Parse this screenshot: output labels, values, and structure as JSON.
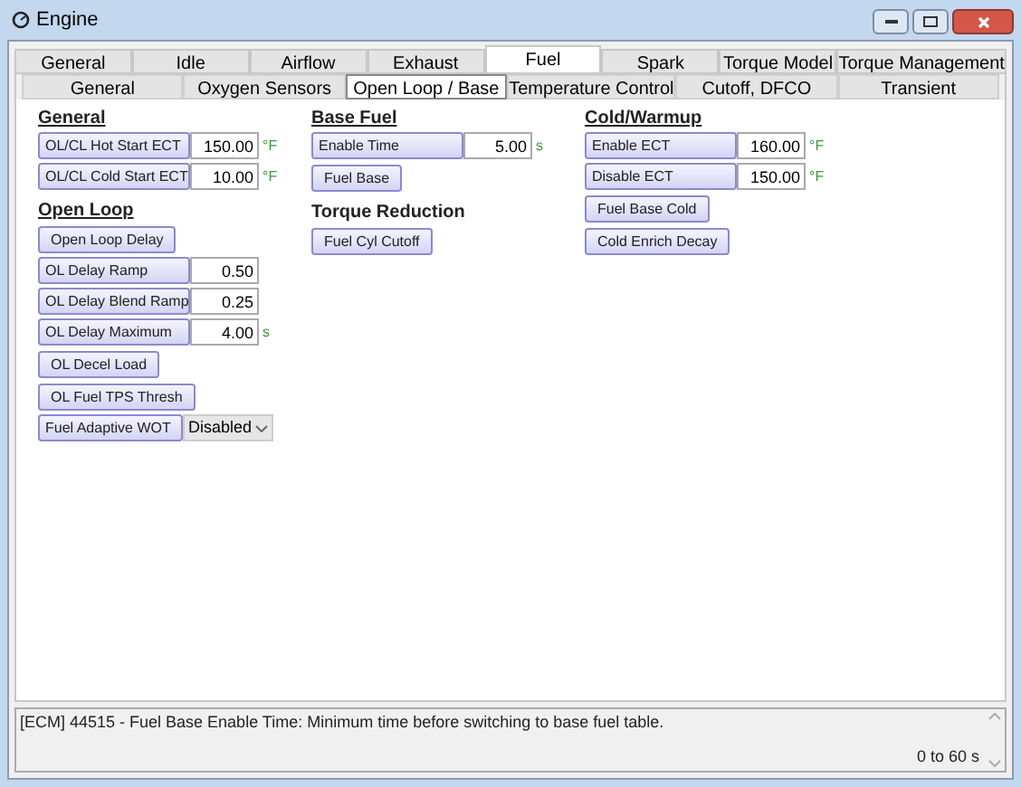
{
  "window": {
    "title": "Engine"
  },
  "tabs": [
    {
      "label": "General",
      "selected": false
    },
    {
      "label": "Idle",
      "selected": false
    },
    {
      "label": "Airflow",
      "selected": false
    },
    {
      "label": "Exhaust",
      "selected": false
    },
    {
      "label": "Fuel",
      "selected": true
    },
    {
      "label": "Spark",
      "selected": false
    },
    {
      "label": "Torque Model",
      "selected": false
    },
    {
      "label": "Torque Management",
      "selected": false
    }
  ],
  "subtabs": [
    {
      "label": "General",
      "selected": false
    },
    {
      "label": "Oxygen Sensors",
      "selected": false
    },
    {
      "label": "Open Loop / Base",
      "selected": true
    },
    {
      "label": "Temperature Control",
      "selected": false
    },
    {
      "label": "Cutoff, DFCO",
      "selected": false
    },
    {
      "label": "Transient",
      "selected": false
    }
  ],
  "columns": [
    [
      {
        "heading": "General",
        "items": [
          {
            "kind": "field",
            "label": "OL/CL Hot Start ECT",
            "value": "150.00",
            "unit": "°F"
          },
          {
            "kind": "field",
            "label": "OL/CL Cold Start ECT",
            "value": "10.00",
            "unit": "°F"
          }
        ]
      },
      {
        "heading": "Open Loop",
        "items": [
          {
            "kind": "button",
            "label": "Open Loop Delay"
          },
          {
            "kind": "field",
            "label": "OL Delay Ramp",
            "value": "0.50"
          },
          {
            "kind": "field",
            "label": "OL Delay Blend Ramp",
            "value": "0.25"
          },
          {
            "kind": "field",
            "label": "OL Delay Maximum",
            "value": "4.00",
            "unit": "s"
          },
          {
            "kind": "button",
            "label": "OL Decel Load"
          },
          {
            "kind": "button",
            "label": "OL Fuel TPS Thresh"
          },
          {
            "kind": "dropdown",
            "label": "Fuel Adaptive WOT",
            "value": "Disabled"
          }
        ]
      }
    ],
    [
      {
        "heading": "Base Fuel",
        "items": [
          {
            "kind": "field",
            "label": "Enable Time",
            "value": "5.00",
            "unit": "s"
          },
          {
            "kind": "button",
            "label": "Fuel Base"
          }
        ]
      },
      {
        "heading": "Torque Reduction",
        "items": [
          {
            "kind": "button",
            "label": "Fuel Cyl Cutoff"
          }
        ]
      }
    ],
    [
      {
        "heading": "Cold/Warmup",
        "items": [
          {
            "kind": "field",
            "label": "Enable ECT",
            "value": "160.00",
            "unit": "°F"
          },
          {
            "kind": "field",
            "label": "Disable ECT",
            "value": "150.00",
            "unit": "°F"
          },
          {
            "kind": "button",
            "label": "Fuel Base Cold"
          },
          {
            "kind": "button",
            "label": "Cold Enrich Decay"
          }
        ]
      }
    ]
  ],
  "status": {
    "message": "[ECM] 44515 - Fuel Base Enable Time: Minimum time before switching to base fuel table.",
    "range": "0 to 60 s"
  }
}
